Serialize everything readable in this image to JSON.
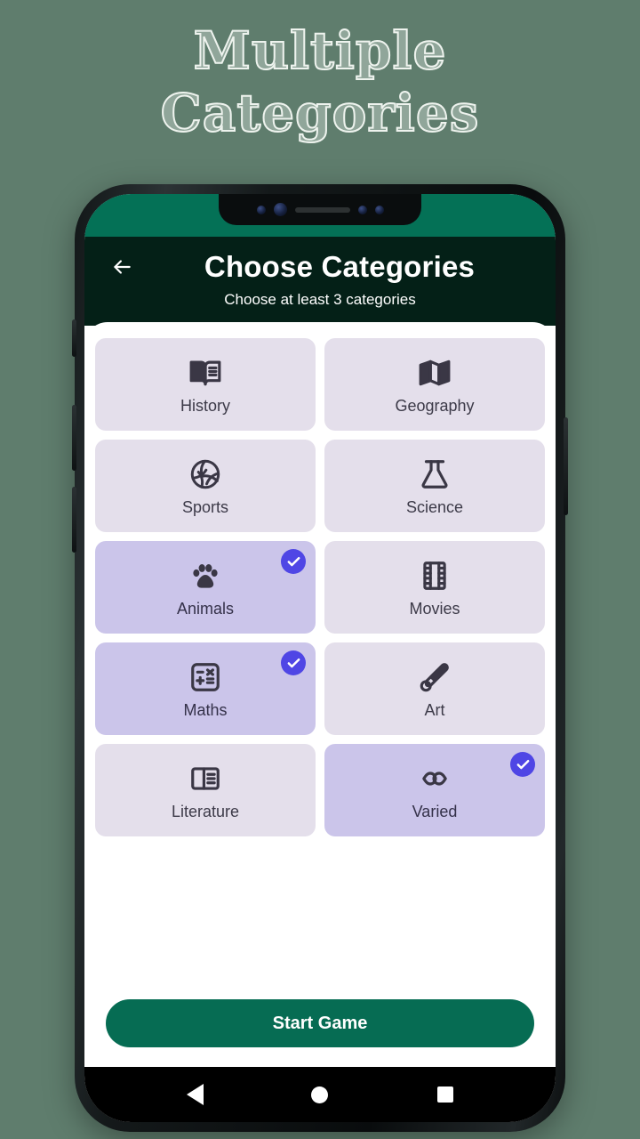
{
  "promo": {
    "line1": "Multiple",
    "line2": "Categories"
  },
  "colors": {
    "page_background": "#5f7d6d",
    "status_bar": "#047156",
    "app_bar": "#042017",
    "tile_unselected": "#e4dfeb",
    "tile_selected": "#cbc5ea",
    "check_badge": "#4f46e5",
    "start_button": "#066c53",
    "icon": "#3a3745"
  },
  "appbar": {
    "back_icon": "arrow-left-icon",
    "title": "Choose Categories",
    "subtitle": "Choose at least 3 categories"
  },
  "categories": [
    {
      "label": "History",
      "icon": "open-book-icon",
      "selected": false
    },
    {
      "label": "Geography",
      "icon": "folded-map-icon",
      "selected": false
    },
    {
      "label": "Sports",
      "icon": "volleyball-icon",
      "selected": false
    },
    {
      "label": "Science",
      "icon": "flask-icon",
      "selected": false
    },
    {
      "label": "Animals",
      "icon": "paw-print-icon",
      "selected": true
    },
    {
      "label": "Movies",
      "icon": "film-strip-icon",
      "selected": false
    },
    {
      "label": "Maths",
      "icon": "calculator-icon",
      "selected": true
    },
    {
      "label": "Art",
      "icon": "paintbrush-icon",
      "selected": false
    },
    {
      "label": "Literature",
      "icon": "article-icon",
      "selected": false
    },
    {
      "label": "Varied",
      "icon": "infinity-icon",
      "selected": true
    }
  ],
  "footer": {
    "start_label": "Start Game"
  },
  "navbar": {
    "back": "triangle-back-icon",
    "home": "circle-home-icon",
    "recents": "square-recents-icon"
  }
}
